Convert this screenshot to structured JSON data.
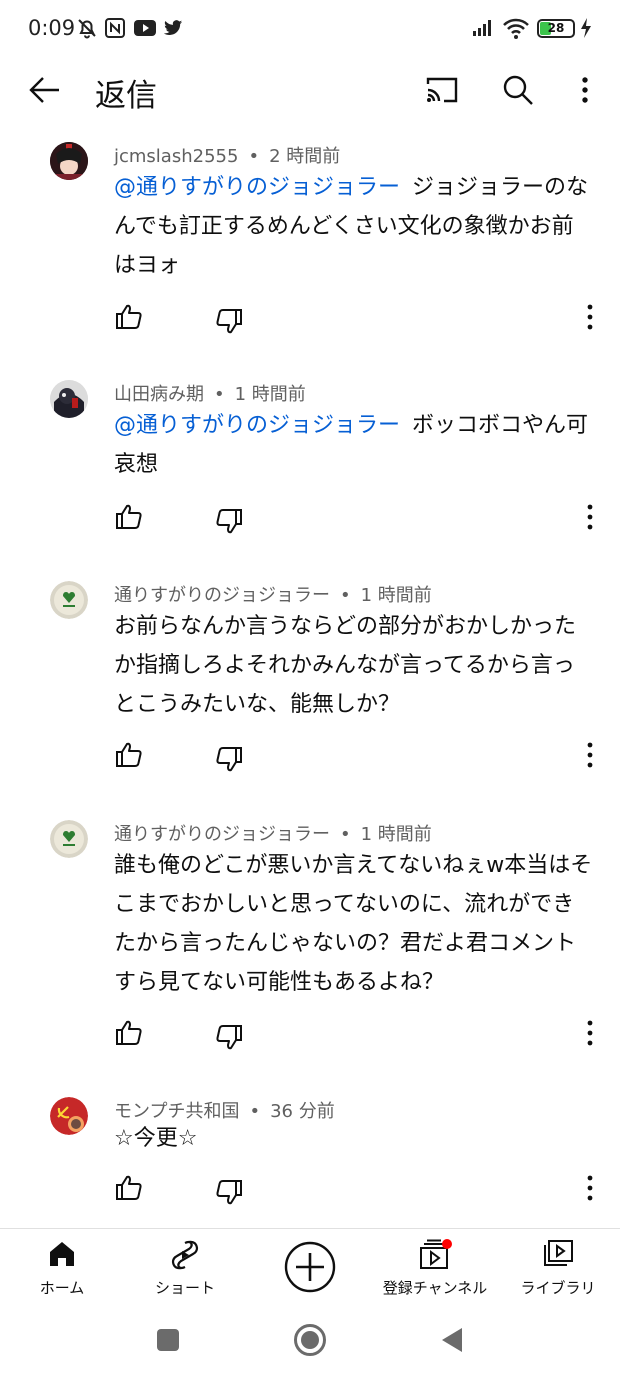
{
  "status_bar": {
    "time": "0:09",
    "battery": "28"
  },
  "app_bar": {
    "title": "返信",
    "icons": [
      "back-arrow-icon",
      "cast-icon",
      "search-icon",
      "more-vert-icon"
    ]
  },
  "comments": [
    {
      "author": "jcmslash2555",
      "time": "2 時間前",
      "mention": "@通りすがりのジョジョラー",
      "text": "ジョジョラーのなんでも訂正するめんどくさい文化の象徴かお前はヨォ"
    },
    {
      "author": "山田病み期",
      "time": "1 時間前",
      "mention": "@通りすがりのジョジョラー",
      "text": "ボッコボコやん可哀想"
    },
    {
      "author": "通りすがりのジョジョラー",
      "time": "1 時間前",
      "mention": "",
      "text": "お前らなんか言うならどの部分がおかしかったか指摘しろよそれかみんなが言ってるから言っとこうみたいな、能無しか？"
    },
    {
      "author": "通りすがりのジョジョラー",
      "time": "1 時間前",
      "mention": "",
      "text": "誰も俺のどこが悪いか言えてないねぇw本当はそこまでおかしいと思ってないのに、流れができたから言ったんじゃないの？君だよ君コメントすら見てない可能性もあるよね？"
    },
    {
      "author": "モンプチ共和国",
      "time": "36 分前",
      "mention": "",
      "text": "☆今更☆"
    }
  ],
  "bottom_nav": {
    "home": "ホーム",
    "shorts": "ショート",
    "subscriptions": "登録チャンネル",
    "library": "ライブラリ"
  },
  "colors": {
    "mention": "#065fd4",
    "meta": "#606060",
    "notification_dot": "#ff0000",
    "battery": "#3cc44b"
  }
}
